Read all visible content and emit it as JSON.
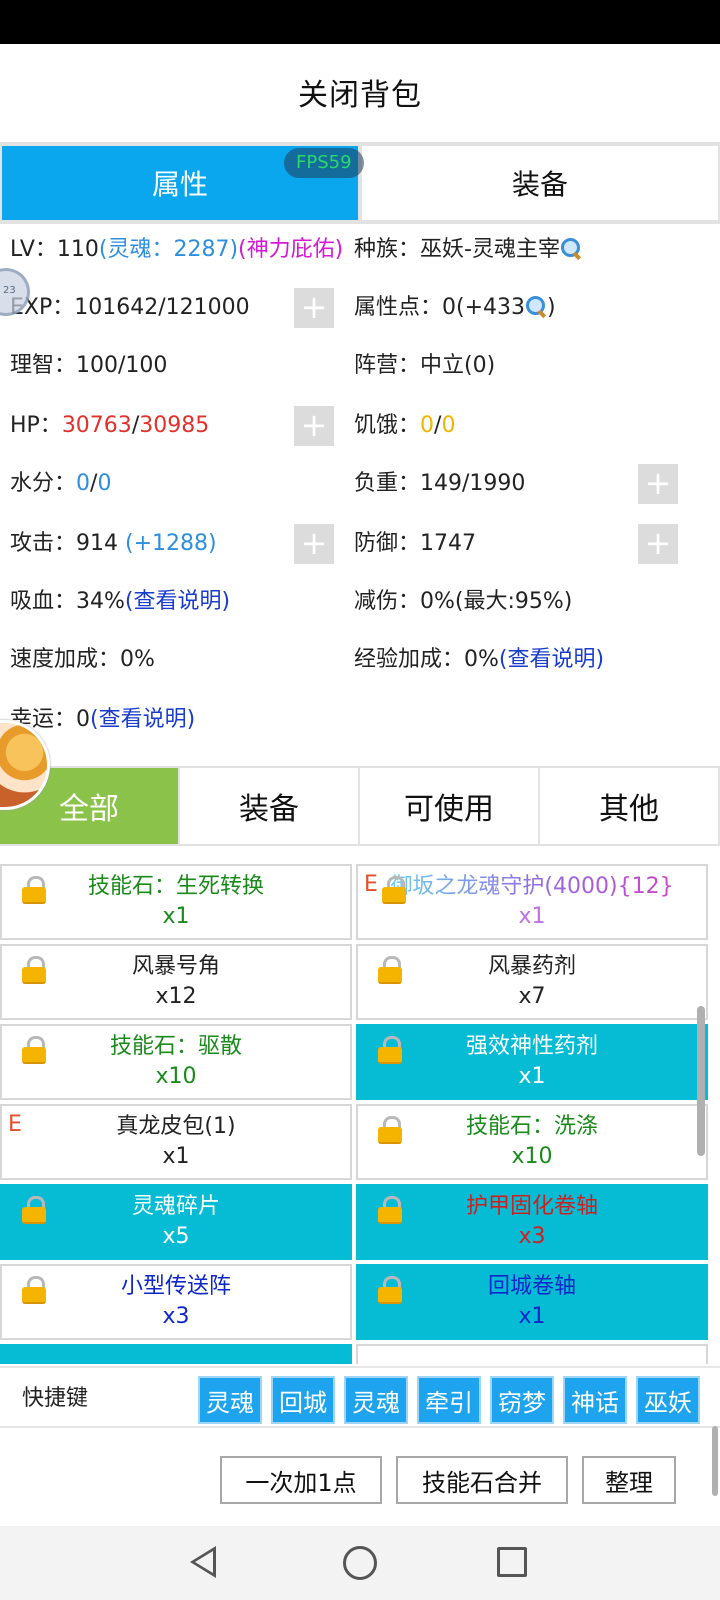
{
  "header": {
    "title": "关闭背包"
  },
  "top_tabs": [
    {
      "label": "属性",
      "active": true
    },
    {
      "label": "装备",
      "active": false
    }
  ],
  "fps": "FPS59",
  "stats": {
    "lv_label": "LV：",
    "lv_value": "110",
    "soul": "(灵魂：2287)",
    "divine": "(神力庇佑)",
    "race_label": "种族：",
    "race_value": "巫妖-灵魂主宰",
    "exp_label": "EXP：",
    "exp_value": "101642/121000",
    "attr_label": "属性点：",
    "attr_value": "0(+433",
    "attr_close": ")",
    "sanity_label": "理智：",
    "sanity_value": "100/100",
    "camp_label": "阵营：",
    "camp_value": "中立(0)",
    "hp_label": "HP：",
    "hp_cur": "30763",
    "hp_sep": "/",
    "hp_max": "30985",
    "hunger_label": "饥饿：",
    "hunger_cur": "0",
    "hunger_sep": "/",
    "hunger_max": "0",
    "water_label": "水分：",
    "water_cur": "0",
    "water_sep": "/",
    "water_max": "0",
    "load_label": "负重：",
    "load_value": "149/1990",
    "atk_label": "攻击：",
    "atk_value": "914",
    "atk_bonus": "(+1288)",
    "def_label": "防御：",
    "def_value": "1747",
    "leech_label": "吸血：",
    "leech_value": "34%",
    "leech_link": "(查看说明)",
    "reduce_label": "减伤：",
    "reduce_value": "0%(最大:95%)",
    "speed_label": "速度加成：",
    "speed_value": "0%",
    "expbonus_label": "经验加成：",
    "expbonus_value": "0%",
    "expbonus_link": "(查看说明)",
    "luck_label": "幸运：",
    "luck_value": "0",
    "luck_link": "(查看说明)",
    "plus": "+"
  },
  "floating_badge": "23",
  "filter_tabs": [
    {
      "label": "全部",
      "active": true
    },
    {
      "label": "装备"
    },
    {
      "label": "可使用"
    },
    {
      "label": "其他"
    }
  ],
  "items": [
    {
      "name": "技能石：生死转换",
      "qty": "x1"
    },
    {
      "name": "御坂之龙魂守护(4000){12}",
      "qty": "x1",
      "emark": "E"
    },
    {
      "name": "风暴号角",
      "qty": "x12"
    },
    {
      "name": "风暴药剂",
      "qty": "x7"
    },
    {
      "name": "技能石：驱散",
      "qty": "x10"
    },
    {
      "name": "强效神性药剂",
      "qty": "x1"
    },
    {
      "name": "真龙皮包(1)",
      "qty": "x1",
      "emark": "E"
    },
    {
      "name": "技能石：洗涤",
      "qty": "x10"
    },
    {
      "name": "灵魂碎片",
      "qty": "x5"
    },
    {
      "name": "护甲固化卷轴",
      "qty": "x3"
    },
    {
      "name": "小型传送阵",
      "qty": "x3"
    },
    {
      "name": "回城卷轴",
      "qty": "x1"
    }
  ],
  "shortcuts": {
    "label": "快捷键",
    "buttons": [
      "灵魂",
      "回城",
      "灵魂",
      "牵引",
      "窃梦",
      "神话",
      "巫妖"
    ]
  },
  "actions": [
    "一次加1点",
    "技能石合并",
    "整理"
  ],
  "colors": {
    "accent_blue": "#0aa6ee",
    "selected_cell": "#06bcd4",
    "active_filter": "#8bc34a"
  }
}
